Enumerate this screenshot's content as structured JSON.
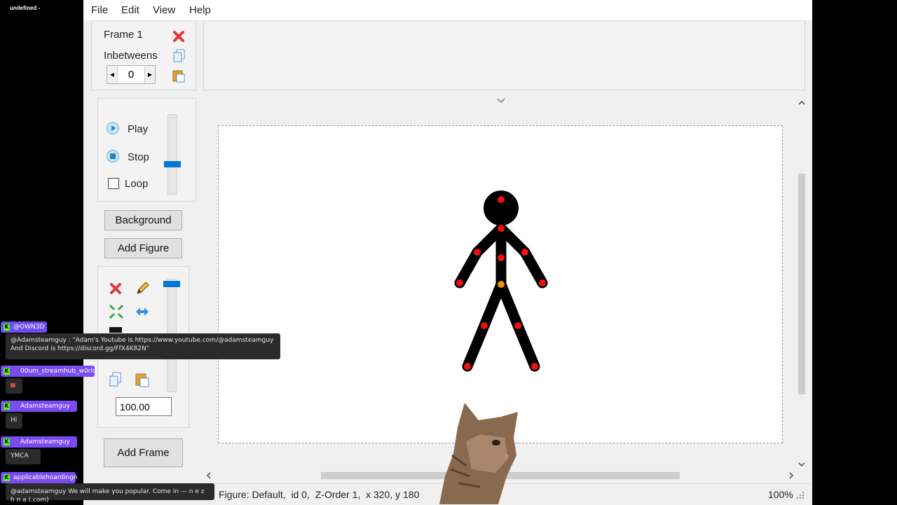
{
  "overlay_title": "undefined -",
  "menu": [
    "File",
    "Edit",
    "View",
    "Help"
  ],
  "frame_panel": {
    "frame_label": "Frame 1",
    "inbetweens_label": "Inbetweens",
    "inbetweens_value": "0"
  },
  "playback": {
    "play": "Play",
    "stop": "Stop",
    "loop": "Loop",
    "loop_checked": false
  },
  "buttons": {
    "background": "Background",
    "add_figure": "Add Figure",
    "add_frame": "Add Frame"
  },
  "figure_tools": {
    "scale_value": "100.00"
  },
  "status_bar": {
    "figure_info": "Figure: Default,  id 0,  Z-Order 1,  x 320, y 180",
    "zoom": "100%"
  },
  "colors": {
    "accent": "#0078d7",
    "joint": "#ee1111",
    "joint_center": "#f29000",
    "kick_green": "#53fc18"
  },
  "chat": [
    {
      "user": "@OWN3D",
      "color": "#6d4cf0",
      "message": "@Adamsteamguy : \"Adam's Youtube is https://www.youtube.com/@adamsteamguy And Discord is https://discord.gg/FfX4K82N\""
    },
    {
      "user": "00um_streamhub_w0rld",
      "color": "#7a4cf0",
      "message": ""
    },
    {
      "user": "Adamsteamguy",
      "color": "#7a4cf0",
      "message": "Hi"
    },
    {
      "user": "Adamsteamguy",
      "color": "#7a4cf0",
      "message": "YMCA"
    },
    {
      "user": "applicablehoardingn",
      "color": "#7a4cf0",
      "message": "@adamsteamguy We will make you popular. Come in — n e z h n a (.com)"
    }
  ]
}
